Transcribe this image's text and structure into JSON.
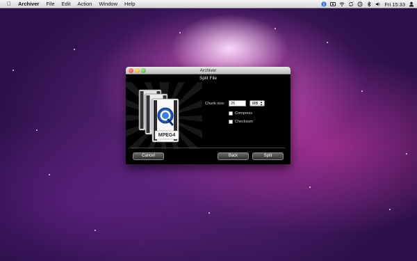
{
  "menubar": {
    "app_name": "Archiver",
    "items": [
      {
        "label": "File"
      },
      {
        "label": "Edit"
      },
      {
        "label": "Action"
      },
      {
        "label": "Window"
      },
      {
        "label": "Help"
      }
    ],
    "clock": "Fri 15:33"
  },
  "window": {
    "title": "Archiver",
    "subtitle": "Split File",
    "file_icon_label": "MPEG4",
    "chunk_label": "Chunk size:",
    "chunk_value": "25",
    "unit_value": "MB",
    "compress_label": "Compress",
    "checksum_label": "Checksum",
    "cancel_label": "Cancel",
    "back_label": "Back",
    "split_label": "Split"
  }
}
